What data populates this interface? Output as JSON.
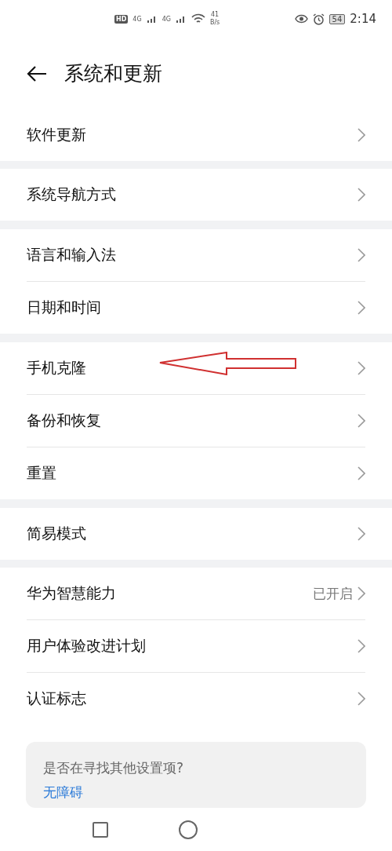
{
  "status_bar": {
    "hd": "HD",
    "network_1": "4G",
    "network_2": "4G",
    "speed": "41",
    "speed_unit": "B/s",
    "battery": "54",
    "time": "2:14"
  },
  "header": {
    "title": "系统和更新"
  },
  "groups": [
    [
      {
        "label": "软件更新"
      }
    ],
    [
      {
        "label": "系统导航方式"
      }
    ],
    [
      {
        "label": "语言和输入法"
      },
      {
        "label": "日期和时间"
      }
    ],
    [
      {
        "label": "手机克隆"
      },
      {
        "label": "备份和恢复"
      },
      {
        "label": "重置"
      }
    ],
    [
      {
        "label": "简易模式"
      }
    ],
    [
      {
        "label": "华为智慧能力",
        "value": "已开启"
      },
      {
        "label": "用户体验改进计划"
      },
      {
        "label": "认证标志"
      }
    ]
  ],
  "suggestion_card": {
    "question": "是否在寻找其他设置项?",
    "link": "无障碍"
  }
}
